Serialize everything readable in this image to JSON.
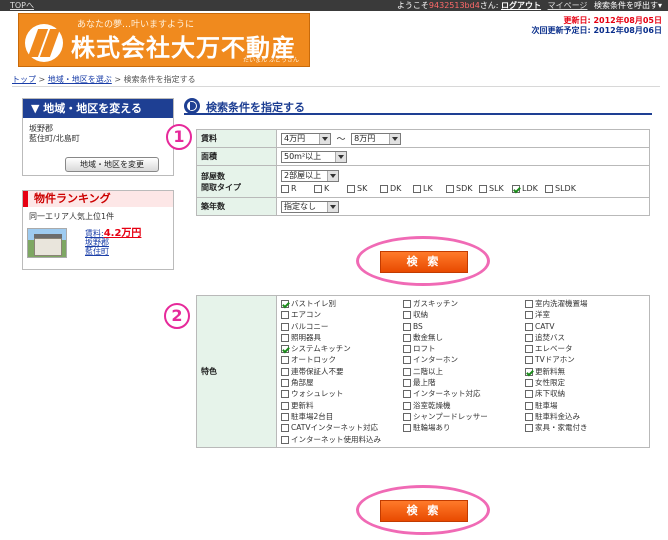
{
  "topbar": {
    "top_link": "TOPへ",
    "welcome_prefix": "ようこそ",
    "user_id": "9432513bd4",
    "welcome_suffix": "さん: ",
    "logout": "ログアウト",
    "mypage": "マイページ",
    "recall": "検索条件を呼出す▾"
  },
  "header": {
    "tagline": "あなたの夢…叶いますように",
    "company": "株式会社大万不動産",
    "kana": "だいまん ふどうさん",
    "update_label": "更新日: 2012年08月05日",
    "next_update_label": "次回更新予定日: 2012年08月06日"
  },
  "breadcrumb": {
    "top": "トップ",
    "area": "地域・地区を選ぶ",
    "current": "検索条件を指定する",
    "sep": " > "
  },
  "sidebar": {
    "area_title": "▼ 地域・地区を変える",
    "area_line1": "坂野郡",
    "area_line2": "藍住町/北島町",
    "area_button": "地域・地区を変更",
    "ranking_title": "物件ランキング",
    "ranking_sub": "同一エリア人気上位1件",
    "rank_rent_label": "賃料:",
    "rank_price": "4.2万円",
    "rank_district": "坂野郡",
    "rank_town": "藍住町"
  },
  "main": {
    "title": "検索条件を指定する",
    "step1": "1",
    "step2": "2",
    "search_button": "検 索",
    "fields": {
      "rent_label": "賃料",
      "rent_min": "4万円",
      "rent_tilde": "～",
      "rent_max": "8万円",
      "area_label": "面積",
      "area_value": "50m²以上",
      "rooms_label": "部屋数",
      "layout_label": "間取タイプ",
      "rooms_value": "2部屋以上",
      "age_label": "築年数",
      "age_value": "指定なし"
    },
    "layout_options": [
      {
        "label": "R",
        "checked": false
      },
      {
        "label": "K",
        "checked": false
      },
      {
        "label": "SK",
        "checked": false
      },
      {
        "label": "DK",
        "checked": false
      },
      {
        "label": "LK",
        "checked": false
      },
      {
        "label": "SDK",
        "checked": false
      },
      {
        "label": "SLK",
        "checked": false
      },
      {
        "label": "LDK",
        "checked": true
      },
      {
        "label": "SLDK",
        "checked": false
      }
    ],
    "features_label": "特色",
    "features": [
      {
        "label": "バストイレ別",
        "checked": true
      },
      {
        "label": "ガスキッチン",
        "checked": false
      },
      {
        "label": "室内洗濯機置場",
        "checked": false
      },
      {
        "label": "エアコン",
        "checked": false
      },
      {
        "label": "収納",
        "checked": false
      },
      {
        "label": "洋室",
        "checked": false
      },
      {
        "label": "バルコニー",
        "checked": false
      },
      {
        "label": "BS",
        "checked": false
      },
      {
        "label": "CATV",
        "checked": false
      },
      {
        "label": "照明器具",
        "checked": false
      },
      {
        "label": "敷金無し",
        "checked": false
      },
      {
        "label": "追焚バス",
        "checked": false
      },
      {
        "label": "システムキッチン",
        "checked": true
      },
      {
        "label": "ロフト",
        "checked": false
      },
      {
        "label": "エレベータ",
        "checked": false
      },
      {
        "label": "オートロック",
        "checked": false
      },
      {
        "label": "インターホン",
        "checked": false
      },
      {
        "label": "TVドアホン",
        "checked": false
      },
      {
        "label": "連帯保証人不要",
        "checked": false
      },
      {
        "label": "二階以上",
        "checked": false
      },
      {
        "label": "更新料無",
        "checked": true
      },
      {
        "label": "角部屋",
        "checked": false
      },
      {
        "label": "最上階",
        "checked": false
      },
      {
        "label": "女性限定",
        "checked": false
      },
      {
        "label": "ウォシュレット",
        "checked": false
      },
      {
        "label": "インターネット対応",
        "checked": false
      },
      {
        "label": "床下収納",
        "checked": false
      },
      {
        "label": "更新料",
        "checked": false
      },
      {
        "label": "浴室乾燥機",
        "checked": false
      },
      {
        "label": "駐車場",
        "checked": false
      },
      {
        "label": "駐車場2台目",
        "checked": false
      },
      {
        "label": "シャンプードレッサー",
        "checked": false
      },
      {
        "label": "駐車料金込み",
        "checked": false
      },
      {
        "label": "CATVインターネット対応",
        "checked": false
      },
      {
        "label": "駐輪場あり",
        "checked": false
      },
      {
        "label": "家具・家電付き",
        "checked": false
      },
      {
        "label": "インターネット使用料込み",
        "checked": false
      }
    ]
  }
}
